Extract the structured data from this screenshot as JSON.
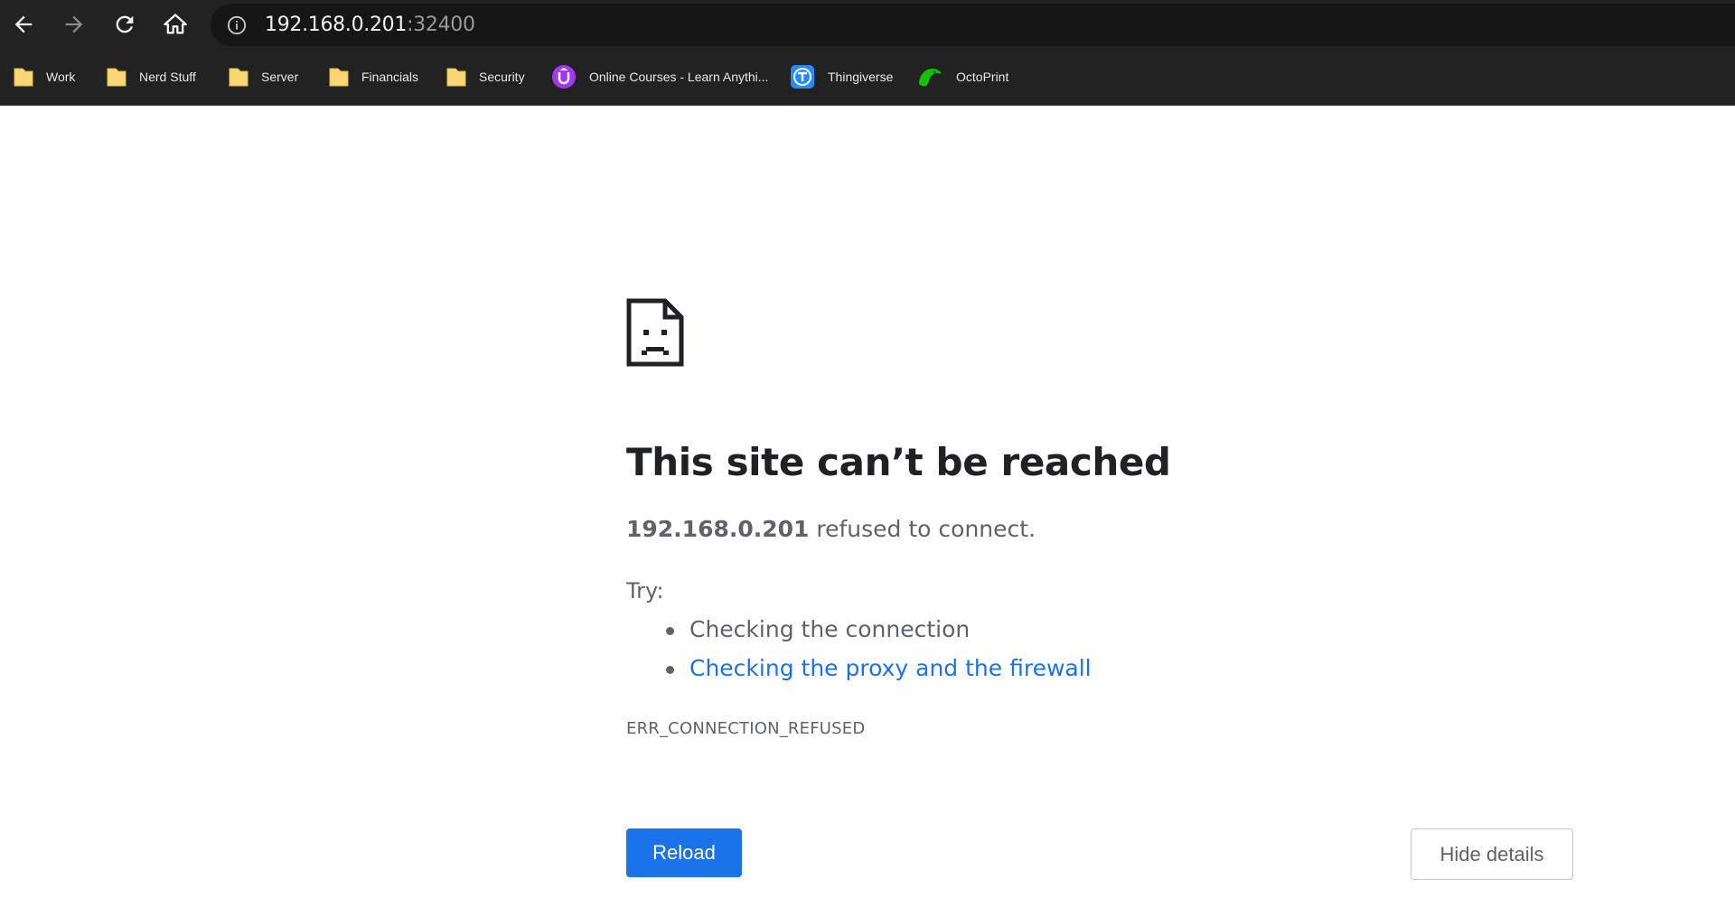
{
  "browser": {
    "address_bar": {
      "host": "192.168.0.201",
      "port": ":32400"
    },
    "nav": {
      "back_icon": "arrow-left-icon",
      "forward_icon": "arrow-right-icon",
      "reload_icon": "reload-icon",
      "home_icon": "home-icon",
      "info_icon": "info-circle-icon"
    },
    "bookmarks": [
      {
        "label": "Work",
        "icon": "folder-icon"
      },
      {
        "label": "Nerd Stuff",
        "icon": "folder-icon"
      },
      {
        "label": "Server",
        "icon": "folder-icon"
      },
      {
        "label": "Financials",
        "icon": "folder-icon"
      },
      {
        "label": "Security",
        "icon": "folder-icon"
      },
      {
        "label": "Online Courses - Learn Anythi...",
        "icon": "udemy-icon"
      },
      {
        "label": "Thingiverse",
        "icon": "thingiverse-icon"
      },
      {
        "label": "OctoPrint",
        "icon": "octoprint-icon"
      }
    ]
  },
  "error_page": {
    "icon": "sad-file-icon",
    "title": "This site can’t be reached",
    "host": "192.168.0.201",
    "summary_suffix": " refused to connect.",
    "try_label": "Try:",
    "suggestions": [
      {
        "text": "Checking the connection",
        "is_link": false
      },
      {
        "text": "Checking the proxy and the firewall",
        "is_link": true
      }
    ],
    "error_code": "ERR_CONNECTION_REFUSED",
    "reload_label": "Reload",
    "details_label": "Hide details"
  },
  "colors": {
    "toolbar_bg": "#222222",
    "omnibox_bg": "#161616",
    "primary_button": "#1a73e8",
    "link": "#1a73e8",
    "body_text": "#5f6368",
    "title_text": "#202124",
    "folder": "#f8d775"
  }
}
